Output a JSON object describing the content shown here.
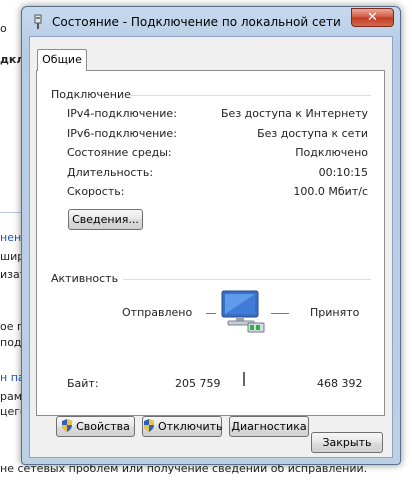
{
  "background": {
    "fragments": [
      "о",
      "дклю",
      "нени",
      "шир",
      "изат",
      "ое пл",
      "подк",
      "н пар",
      "рам,",
      "цего",
      "не сетевых проблем или получение сведений об исправлении."
    ]
  },
  "window": {
    "title": "Состояние - Подключение по локальной сети",
    "close_glyph": "✕"
  },
  "tabs": [
    {
      "label": "Общие"
    }
  ],
  "connection": {
    "heading": "Подключение",
    "rows": [
      {
        "label": "IPv4-подключение:",
        "value": "Без доступа к Интернету"
      },
      {
        "label": "IPv6-подключение:",
        "value": "Без доступа к сети"
      },
      {
        "label": "Состояние среды:",
        "value": "Подключено"
      },
      {
        "label": "Длительность:",
        "value": "00:10:15"
      },
      {
        "label": "Скорость:",
        "value": "100.0 Мбит/с"
      }
    ],
    "details_button": "Сведения..."
  },
  "activity": {
    "heading": "Активность",
    "sent_label": "Отправлено",
    "received_label": "Принято",
    "bytes_label": "Байт:",
    "sent_value": "205 759",
    "received_value": "468 392"
  },
  "buttons": {
    "properties": "Свойства",
    "disable": "Отключить",
    "diagnose": "Диагностика",
    "close": "Закрыть"
  },
  "colors": {
    "accent": "#1a55b5",
    "titlebar": "#c6d9ee",
    "close": "#c03b24"
  },
  "icons": [
    "network-connection-icon",
    "close-icon",
    "computer-network-icon",
    "uac-shield-icon"
  ]
}
